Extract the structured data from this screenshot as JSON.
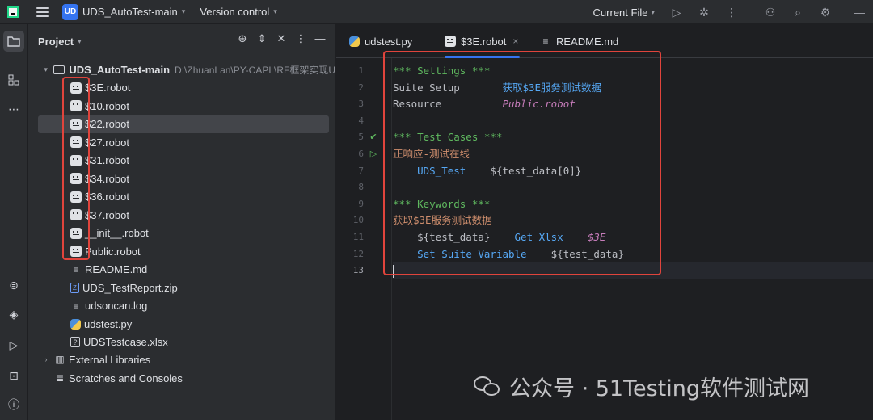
{
  "titlebar": {
    "project_badge": "UD",
    "project_name": "UDS_AutoTest-main",
    "vcs": "Version control",
    "current_file": "Current File"
  },
  "project_panel": {
    "title": "Project",
    "root": {
      "name": "UDS_AutoTest-main",
      "path": "D:\\ZhuanLan\\PY-CAPL\\RF框架实现U"
    },
    "files": [
      {
        "name": "$3E.robot",
        "icon": "robot-file-icon"
      },
      {
        "name": "$10.robot",
        "icon": "robot-file-icon"
      },
      {
        "name": "$22.robot",
        "icon": "robot-file-icon",
        "selected": true
      },
      {
        "name": "$27.robot",
        "icon": "robot-file-icon"
      },
      {
        "name": "$31.robot",
        "icon": "robot-file-icon"
      },
      {
        "name": "$34.robot",
        "icon": "robot-file-icon"
      },
      {
        "name": "$36.robot",
        "icon": "robot-file-icon"
      },
      {
        "name": "$37.robot",
        "icon": "robot-file-icon"
      },
      {
        "name": "__init__.robot",
        "icon": "robot-file-icon"
      },
      {
        "name": "Public.robot",
        "icon": "robot-file-icon"
      },
      {
        "name": "README.md",
        "icon": "markdown-file-icon"
      },
      {
        "name": "UDS_TestReport.zip",
        "icon": "zip-file-icon"
      },
      {
        "name": "udsoncan.log",
        "icon": "log-file-icon"
      },
      {
        "name": "udstest.py",
        "icon": "python-file-icon"
      },
      {
        "name": "UDSTestcase.xlsx",
        "icon": "xlsx-file-icon"
      }
    ],
    "external_libraries": "External Libraries",
    "scratches": "Scratches and Consoles"
  },
  "editor": {
    "tabs": [
      {
        "label": "udstest.py",
        "icon": "python-file-icon"
      },
      {
        "label": "$3E.robot",
        "icon": "robot-file-icon",
        "active": true
      },
      {
        "label": "README.md",
        "icon": "markdown-file-icon"
      }
    ],
    "lines": [
      {
        "n": "1",
        "parts": [
          [
            "c-section",
            "*** Settings ***"
          ]
        ]
      },
      {
        "n": "2",
        "parts": [
          [
            "c-setting",
            "Suite Setup       "
          ],
          [
            "c-kw",
            "获取$3E服务测试数据"
          ]
        ]
      },
      {
        "n": "3",
        "parts": [
          [
            "c-setting",
            "Resource          "
          ],
          [
            "c-res",
            "Public.robot"
          ]
        ]
      },
      {
        "n": "4",
        "parts": []
      },
      {
        "n": "5",
        "parts": [
          [
            "c-section",
            "*** Test Cases ***"
          ]
        ],
        "gutter": "check-run-icon"
      },
      {
        "n": "6",
        "parts": [
          [
            "c-name",
            "正响应-测试在线"
          ]
        ],
        "gutter": "run-icon"
      },
      {
        "n": "7",
        "parts": [
          [
            "c-var",
            "    "
          ],
          [
            "c-kw",
            "UDS_Test"
          ],
          [
            "c-var",
            "    ${test_data[0]}"
          ]
        ]
      },
      {
        "n": "8",
        "parts": []
      },
      {
        "n": "9",
        "parts": [
          [
            "c-section",
            "*** Keywords ***"
          ]
        ]
      },
      {
        "n": "10",
        "parts": [
          [
            "c-name",
            "获取$3E服务测试数据"
          ]
        ]
      },
      {
        "n": "11",
        "parts": [
          [
            "c-var",
            "    ${test_data}    "
          ],
          [
            "c-kw",
            "Get Xlsx"
          ],
          [
            "c-var",
            "    "
          ],
          [
            "c-arg",
            "$3E"
          ]
        ]
      },
      {
        "n": "12",
        "parts": [
          [
            "c-var",
            "    "
          ],
          [
            "c-kw",
            "Set Suite Variable"
          ],
          [
            "c-var",
            "    ${test_data}"
          ]
        ]
      },
      {
        "n": "13",
        "parts": [],
        "current": true
      }
    ]
  },
  "watermark": {
    "text": "公众号 · 51Testing软件测试网"
  }
}
